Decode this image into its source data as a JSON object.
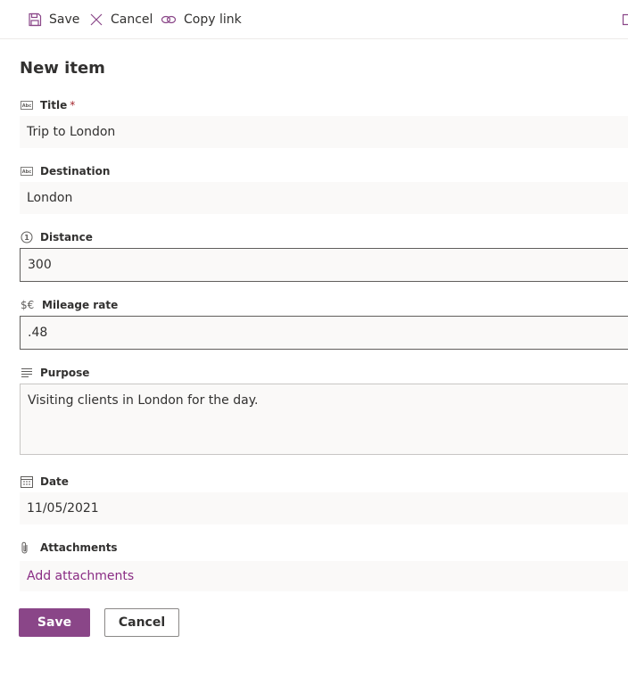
{
  "toolbar": {
    "save_label": "Save",
    "cancel_label": "Cancel",
    "copy_link_label": "Copy link"
  },
  "form": {
    "title": "New item",
    "fields": {
      "title": {
        "label": "Title",
        "required_mark": "*",
        "value": "Trip to London",
        "icon": "text-field-icon"
      },
      "destination": {
        "label": "Destination",
        "value": "London",
        "icon": "text-field-icon"
      },
      "distance": {
        "label": "Distance",
        "value": "300",
        "icon": "number-icon"
      },
      "mileage_rate": {
        "label": "Mileage rate",
        "value": ".48",
        "icon": "currency-icon",
        "icon_text": "$€"
      },
      "purpose": {
        "label": "Purpose",
        "value": "Visiting clients in London for the day.",
        "icon": "multiline-text-icon"
      },
      "date": {
        "label": "Date",
        "value": "11/05/2021",
        "icon": "calendar-icon"
      },
      "attachments": {
        "label": "Attachments",
        "link_text": "Add attachments",
        "icon": "paperclip-icon"
      }
    }
  },
  "footer": {
    "save_label": "Save",
    "cancel_label": "Cancel"
  },
  "colors": {
    "accent": "#8a4688",
    "link": "#8a2c84",
    "field_bg": "#faf9f8",
    "required": "#a4262c"
  }
}
